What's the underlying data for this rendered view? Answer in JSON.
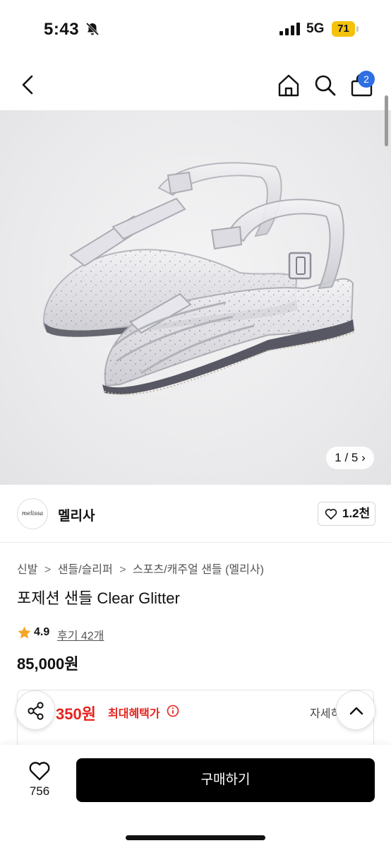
{
  "status_bar": {
    "time": "5:43",
    "network": "5G",
    "battery": "71",
    "icons": [
      "bell-off-icon",
      "signal-icon",
      "battery-icon"
    ]
  },
  "header": {
    "icons": [
      "back-icon",
      "home-icon",
      "search-icon",
      "cart-icon"
    ],
    "cart_badge": "2"
  },
  "gallery": {
    "counter": "1 / 5 ›",
    "current": 1,
    "total": 5
  },
  "brand": {
    "logo_text": "melissa",
    "name": "멜리사",
    "likes": "1.2천"
  },
  "product": {
    "breadcrumb": [
      "신발",
      "샌들/슬리퍼",
      "스포츠/캐주얼 샌들 (멜리사)"
    ],
    "breadcrumb_separator": ">",
    "title": "포제션 샌들 Clear Glitter",
    "rating": "4.9",
    "reviews": "후기 42개",
    "price": "85,000원"
  },
  "benefit": {
    "amount": "350원",
    "label": "최대혜택가",
    "detail": "자세히"
  },
  "bottom_bar": {
    "wish_count": "756",
    "buy_label": "구매하기"
  },
  "colors": {
    "accent_red": "#e5231f",
    "badge_blue": "#2f6fe4",
    "battery_yellow": "#f4c20d",
    "star": "#f5a623",
    "buy_button": "#000000"
  }
}
